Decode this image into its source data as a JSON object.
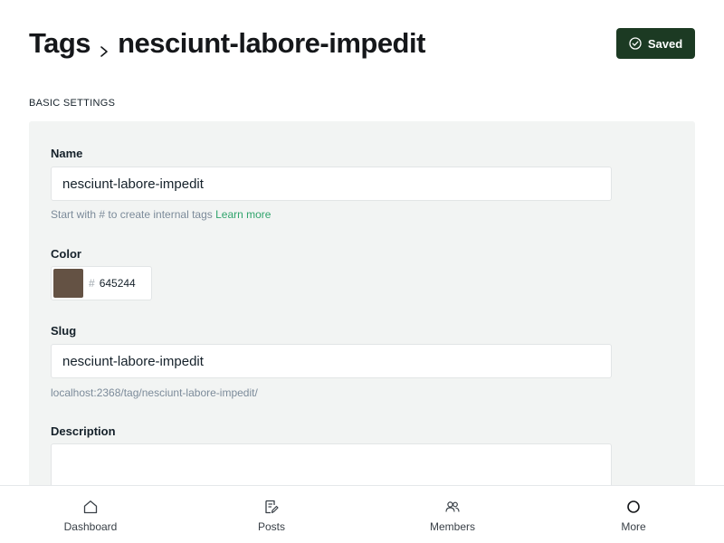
{
  "header": {
    "breadcrumb_parent": "Tags",
    "breadcrumb_current": "nesciunt-labore-impedit",
    "saved_label": "Saved"
  },
  "section": {
    "title": "BASIC SETTINGS"
  },
  "form": {
    "name": {
      "label": "Name",
      "value": "nesciunt-labore-impedit",
      "hint_prefix": "Start with # to create internal tags",
      "hint_link": "Learn more"
    },
    "color": {
      "label": "Color",
      "hash": "#",
      "value": "645244",
      "swatch_hex": "#645244"
    },
    "slug": {
      "label": "Slug",
      "value": "nesciunt-labore-impedit",
      "url": "localhost:2368/tag/nesciunt-labore-impedit/"
    },
    "description": {
      "label": "Description",
      "value": ""
    }
  },
  "nav": {
    "items": [
      {
        "label": "Dashboard",
        "icon": "home-icon"
      },
      {
        "label": "Posts",
        "icon": "posts-icon"
      },
      {
        "label": "Members",
        "icon": "members-icon"
      },
      {
        "label": "More",
        "icon": "circle-icon"
      }
    ]
  },
  "colors": {
    "saved_button": "#1c3a23",
    "link": "#30a46c",
    "panel_bg": "#f2f4f3"
  }
}
